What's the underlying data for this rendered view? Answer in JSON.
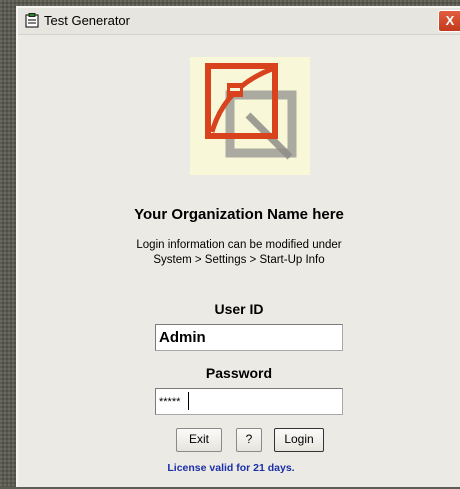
{
  "window": {
    "title": "Test Generator",
    "close_glyph": "X",
    "icon": "app-clipboard-icon"
  },
  "logo": {
    "icon": "red-pen-on-notepad-logo"
  },
  "org": {
    "name": "Your Organization Name here",
    "info_line1": "Login information can be modified under",
    "info_line2": "System > Settings > Start-Up Info"
  },
  "form": {
    "user_id_label": "User ID",
    "user_id_value": "Admin",
    "password_label": "Password",
    "password_value": "*****"
  },
  "buttons": {
    "exit": "Exit",
    "help": "?",
    "login": "Login"
  },
  "license": {
    "text": "License valid for 21 days."
  },
  "colors": {
    "license_text": "#1a2fa8",
    "logo_red": "#d8421c",
    "logo_bg": "#f8f7d8",
    "window_bg": "#eceae4"
  }
}
